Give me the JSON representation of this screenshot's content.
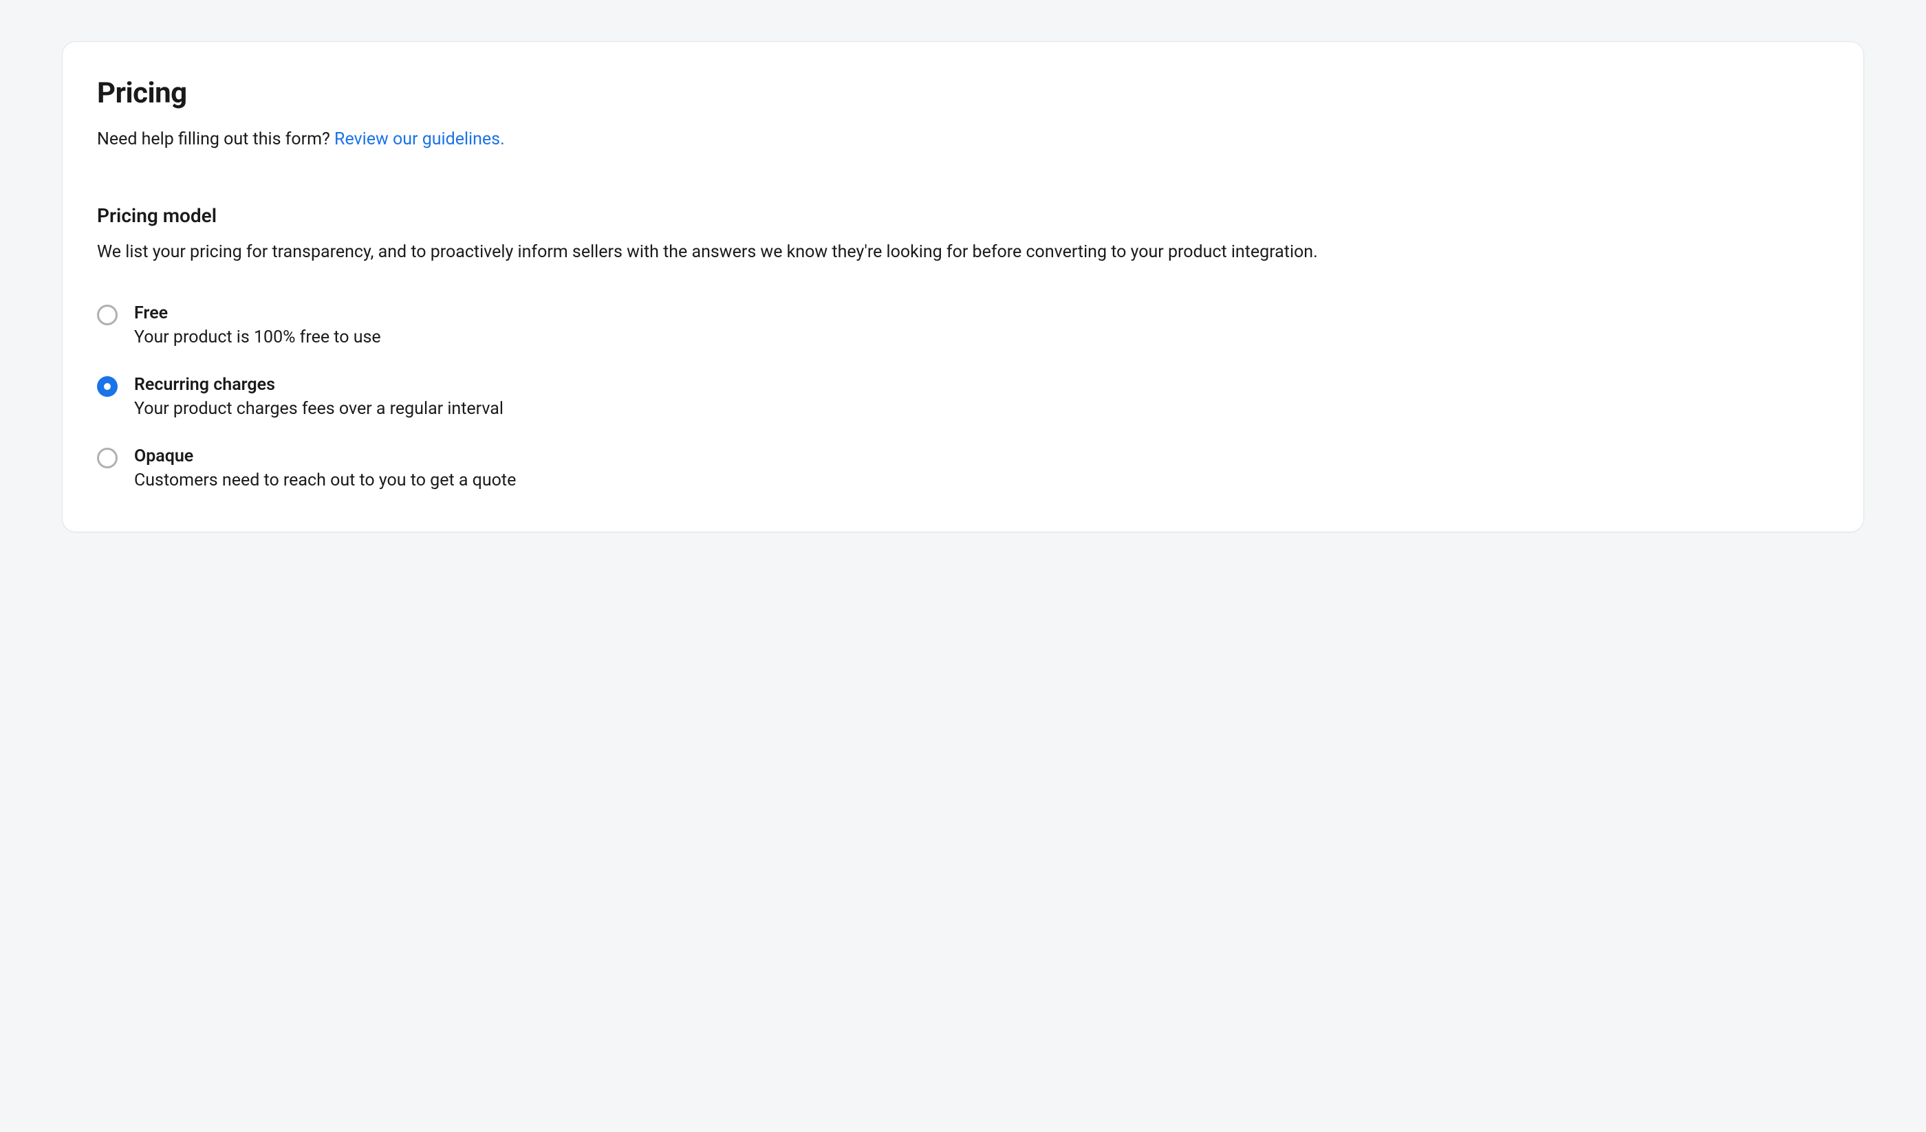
{
  "title": "Pricing",
  "help": {
    "text": "Need help filling out this form? ",
    "link_text": "Review our guidelines."
  },
  "section": {
    "title": "Pricing model",
    "description": "We list your pricing for transparency, and to proactively inform sellers with the answers we know they're looking for before converting to your product integration."
  },
  "options": [
    {
      "label": "Free",
      "description": "Your product is 100% free to use",
      "selected": false
    },
    {
      "label": "Recurring charges",
      "description": "Your product charges fees over a regular interval",
      "selected": true
    },
    {
      "label": "Opaque",
      "description": "Customers need to reach out to you to get a quote",
      "selected": false
    }
  ]
}
